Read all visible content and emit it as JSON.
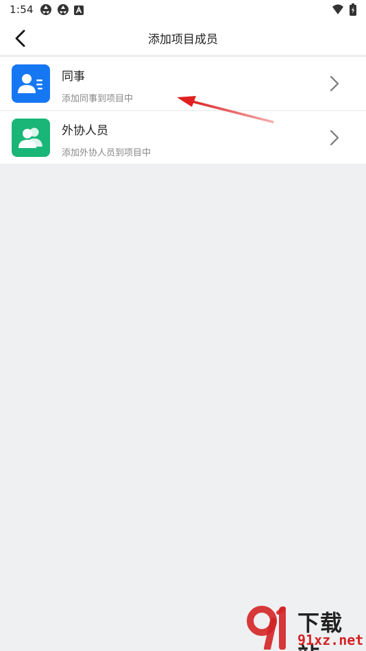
{
  "status_bar": {
    "time": "1:54",
    "left_icons": [
      "aperture-icon",
      "aperture-icon",
      "a-icon"
    ],
    "right_icons": [
      "wifi-icon",
      "battery-charging-icon"
    ]
  },
  "app_bar": {
    "back_icon": "back-arrow-icon",
    "title": "添加项目成员"
  },
  "list": {
    "items": [
      {
        "title": "同事",
        "subtitle": "添加同事到项目中",
        "icon": "contact-card-icon",
        "icon_color": "#1677f3"
      },
      {
        "title": "外协人员",
        "subtitle": "添加外协人员到项目中",
        "icon": "two-people-icon",
        "icon_color": "#19b677"
      }
    ]
  },
  "annotation": {
    "color": "#e02020"
  },
  "watermark": {
    "text": "下载站",
    "url": "91xz.net",
    "logo_digits": "91",
    "accent_color": "#d42325"
  },
  "colors": {
    "background": "#eff0f2",
    "surface": "#ffffff"
  }
}
